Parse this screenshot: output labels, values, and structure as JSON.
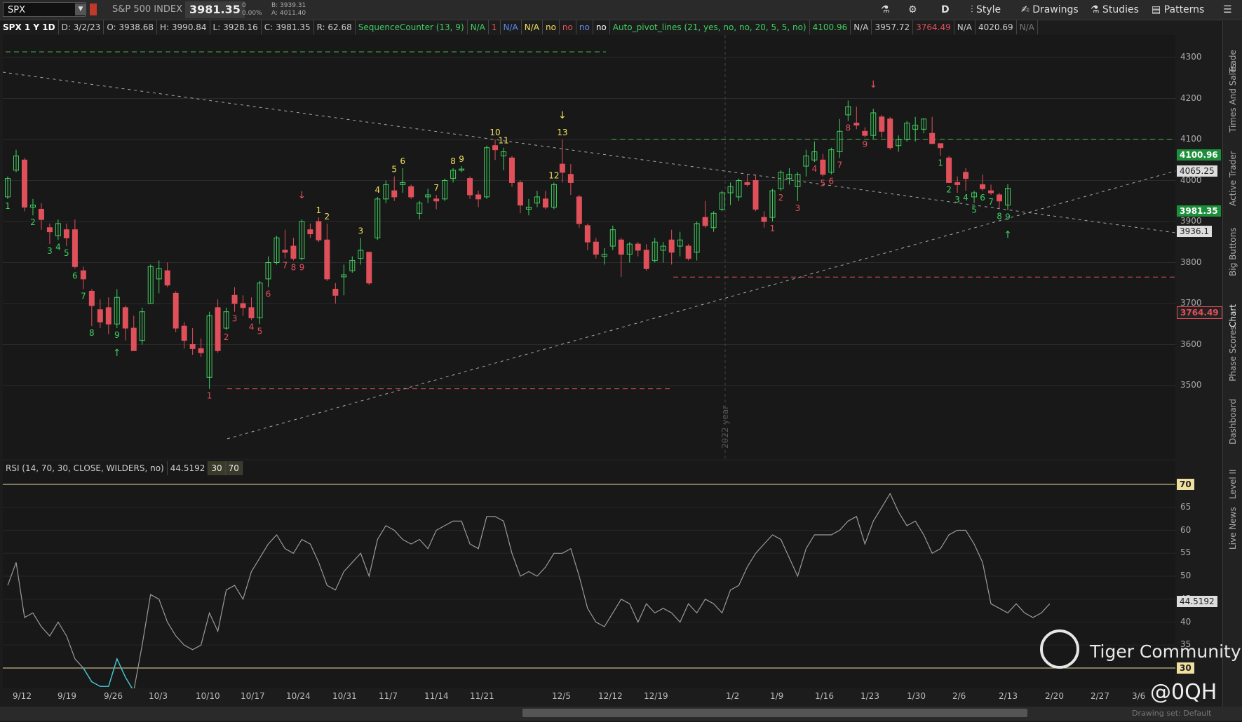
{
  "topbar": {
    "symbol": "SPX",
    "symbol_name": "S&P 500 INDEX",
    "last": "3981.35",
    "change": "0",
    "change_pct": "0.00%",
    "bid": "B: 3939.31",
    "ask": "A: 4011.40",
    "timeframe": "D",
    "buttons": [
      "Style",
      "Drawings",
      "Studies",
      "Patterns"
    ]
  },
  "subheader": {
    "title": "SPX 1 Y 1D",
    "date": "D: 3/2/23",
    "open": "O: 3938.68",
    "high": "H: 3990.84",
    "low": "L: 3928.16",
    "close": "C: 3981.35",
    "range": "R: 62.68",
    "seq": "SequenceCounter (13, 9)",
    "seq_vals": [
      "N/A",
      "1",
      "N/A",
      "N/A",
      "no",
      "no",
      "no",
      "no"
    ],
    "pivot": "Auto_pivot_lines (21, yes, no, no, 20, 5, 5, no)",
    "pivot_vals": [
      "4100.96",
      "N/A",
      "3957.72",
      "3764.49",
      "N/A",
      "4020.69",
      "N/A"
    ]
  },
  "price_axis": [
    "4300",
    "4200",
    "4100",
    "4000",
    "3900",
    "3800",
    "3700",
    "3600",
    "3500"
  ],
  "price_tags": {
    "resistance": "4100.96",
    "level2": "4065.25",
    "last": "3981.35",
    "level4": "3936.1",
    "support": "3764.49"
  },
  "rsi": {
    "label": "RSI (14, 70, 30, CLOSE, WILDERS, no)",
    "value": "44.5192",
    "os": "30",
    "ob": "70",
    "axis": [
      "65",
      "60",
      "55",
      "50",
      "45",
      "40",
      "35"
    ]
  },
  "dates": [
    "9/12",
    "9/19",
    "9/26",
    "10/3",
    "10/10",
    "10/17",
    "10/24",
    "10/31",
    "11/7",
    "11/14",
    "11/21",
    "12/5",
    "12/12",
    "12/19",
    "1/2",
    "1/9",
    "1/16",
    "1/23",
    "1/30",
    "2/6",
    "2/13",
    "2/20",
    "2/27",
    "3/6"
  ],
  "year_label": "2022 year",
  "side_tabs": [
    "Trade",
    "Times And Sales",
    "Active Trader",
    "Big Buttons",
    "Chart",
    "Phase Scores",
    "Dashboard",
    "Level II",
    "Live News"
  ],
  "watermark": "Tiger Community",
  "handle": "@0QH",
  "drawing_set": "Drawing set: Default",
  "colors": {
    "up": "#3fcf5f",
    "down": "#e0505a",
    "bg": "#181818",
    "resistance": "#3fb43f",
    "support": "#e0505a"
  },
  "candles": [
    {
      "d": "9/8",
      "o": 3960,
      "c": 4005,
      "h": 4010,
      "l": 3955
    },
    {
      "d": "9/9",
      "o": 4025,
      "c": 4060,
      "h": 4075,
      "l": 4020
    },
    {
      "d": "9/13",
      "o": 4050,
      "c": 3935,
      "h": 4055,
      "l": 3925
    },
    {
      "d": "9/14",
      "o": 3935,
      "c": 3940,
      "h": 3955,
      "l": 3915
    },
    {
      "d": "9/15",
      "o": 3930,
      "c": 3905,
      "h": 3945,
      "l": 3880
    },
    {
      "d": "9/16",
      "o": 3885,
      "c": 3875,
      "h": 3895,
      "l": 3845
    },
    {
      "d": "9/19",
      "o": 3865,
      "c": 3895,
      "h": 3905,
      "l": 3855
    },
    {
      "d": "9/20",
      "o": 3880,
      "c": 3860,
      "h": 3895,
      "l": 3840
    },
    {
      "d": "9/21",
      "o": 3880,
      "c": 3790,
      "h": 3905,
      "l": 3785
    },
    {
      "d": "9/22",
      "o": 3780,
      "c": 3760,
      "h": 3790,
      "l": 3735
    },
    {
      "d": "9/23",
      "o": 3730,
      "c": 3695,
      "h": 3735,
      "l": 3645
    },
    {
      "d": "9/26",
      "o": 3685,
      "c": 3655,
      "h": 3710,
      "l": 3640
    },
    {
      "d": "9/27",
      "o": 3690,
      "c": 3650,
      "h": 3715,
      "l": 3625
    },
    {
      "d": "9/28",
      "o": 3650,
      "c": 3715,
      "h": 3735,
      "l": 3640
    },
    {
      "d": "9/29",
      "o": 3690,
      "c": 3640,
      "h": 3695,
      "l": 3610
    },
    {
      "d": "9/30",
      "o": 3640,
      "c": 3585,
      "h": 3670,
      "l": 3585
    },
    {
      "d": "10/3",
      "o": 3610,
      "c": 3680,
      "h": 3690,
      "l": 3600
    },
    {
      "d": "10/4",
      "o": 3700,
      "c": 3790,
      "h": 3795,
      "l": 3700
    },
    {
      "d": "10/5",
      "o": 3760,
      "c": 3785,
      "h": 3805,
      "l": 3725
    },
    {
      "d": "10/6",
      "o": 3780,
      "c": 3745,
      "h": 3800,
      "l": 3740
    },
    {
      "d": "10/7",
      "o": 3725,
      "c": 3640,
      "h": 3730,
      "l": 3630
    },
    {
      "d": "10/10",
      "o": 3645,
      "c": 3610,
      "h": 3655,
      "l": 3590
    },
    {
      "d": "10/11",
      "o": 3600,
      "c": 3590,
      "h": 3640,
      "l": 3575
    },
    {
      "d": "10/12",
      "o": 3590,
      "c": 3580,
      "h": 3615,
      "l": 3570
    },
    {
      "d": "10/13",
      "o": 3520,
      "c": 3670,
      "h": 3680,
      "l": 3492
    },
    {
      "d": "10/14",
      "o": 3690,
      "c": 3585,
      "h": 3710,
      "l": 3580
    },
    {
      "d": "10/17",
      "o": 3640,
      "c": 3680,
      "h": 3690,
      "l": 3635
    },
    {
      "d": "10/18",
      "o": 3720,
      "c": 3700,
      "h": 3740,
      "l": 3680
    },
    {
      "d": "10/19",
      "o": 3700,
      "c": 3690,
      "h": 3720,
      "l": 3670
    },
    {
      "d": "10/20",
      "o": 3690,
      "c": 3665,
      "h": 3715,
      "l": 3660
    },
    {
      "d": "10/21",
      "o": 3665,
      "c": 3750,
      "h": 3755,
      "l": 3650
    },
    {
      "d": "10/24",
      "o": 3760,
      "c": 3800,
      "h": 3815,
      "l": 3740
    },
    {
      "d": "10/25",
      "o": 3800,
      "c": 3860,
      "h": 3865,
      "l": 3795
    },
    {
      "d": "10/26",
      "o": 3830,
      "c": 3825,
      "h": 3880,
      "l": 3810
    },
    {
      "d": "10/27",
      "o": 3840,
      "c": 3810,
      "h": 3860,
      "l": 3805
    },
    {
      "d": "10/28",
      "o": 3810,
      "c": 3900,
      "h": 3905,
      "l": 3805
    },
    {
      "d": "10/31",
      "o": 3880,
      "c": 3870,
      "h": 3895,
      "l": 3860
    },
    {
      "d": "11/1",
      "o": 3900,
      "c": 3855,
      "h": 3910,
      "l": 3850
    },
    {
      "d": "11/2",
      "o": 3855,
      "c": 3760,
      "h": 3895,
      "l": 3755
    },
    {
      "d": "11/3",
      "o": 3735,
      "c": 3720,
      "h": 3750,
      "l": 3700
    },
    {
      "d": "11/4",
      "o": 3765,
      "c": 3770,
      "h": 3795,
      "l": 3720
    },
    {
      "d": "11/7",
      "o": 3780,
      "c": 3805,
      "h": 3815,
      "l": 3775
    },
    {
      "d": "11/8",
      "o": 3810,
      "c": 3830,
      "h": 3860,
      "l": 3795
    },
    {
      "d": "11/9",
      "o": 3825,
      "c": 3750,
      "h": 3825,
      "l": 3745
    },
    {
      "d": "11/10",
      "o": 3860,
      "c": 3955,
      "h": 3960,
      "l": 3855
    },
    {
      "d": "11/11",
      "o": 3955,
      "c": 3990,
      "h": 4000,
      "l": 3945
    },
    {
      "d": "11/14",
      "o": 3975,
      "c": 3960,
      "h": 4010,
      "l": 3950
    },
    {
      "d": "11/15",
      "o": 3990,
      "c": 3995,
      "h": 4030,
      "l": 3970
    },
    {
      "d": "11/16",
      "o": 3985,
      "c": 3960,
      "h": 3990,
      "l": 3955
    },
    {
      "d": "11/17",
      "o": 3920,
      "c": 3945,
      "h": 3950,
      "l": 3905
    },
    {
      "d": "11/18",
      "o": 3960,
      "c": 3965,
      "h": 3980,
      "l": 3945
    },
    {
      "d": "11/21",
      "o": 3955,
      "c": 3950,
      "h": 3965,
      "l": 3930
    },
    {
      "d": "11/22",
      "o": 3955,
      "c": 4000,
      "h": 4005,
      "l": 3950
    },
    {
      "d": "11/23",
      "o": 4005,
      "c": 4025,
      "h": 4030,
      "l": 3995
    },
    {
      "d": "11/25",
      "o": 4025,
      "c": 4028,
      "h": 4035,
      "l": 4020
    },
    {
      "d": "11/28",
      "o": 4005,
      "c": 3965,
      "h": 4010,
      "l": 3955
    },
    {
      "d": "11/29",
      "o": 3965,
      "c": 3955,
      "h": 3975,
      "l": 3935
    },
    {
      "d": "11/30",
      "o": 3960,
      "c": 4080,
      "h": 4085,
      "l": 3955
    },
    {
      "d": "12/1",
      "o": 4085,
      "c": 4075,
      "h": 4100,
      "l": 4050
    },
    {
      "d": "12/2",
      "o": 4060,
      "c": 4070,
      "h": 4080,
      "l": 4025
    },
    {
      "d": "12/5",
      "o": 4055,
      "c": 3995,
      "h": 4060,
      "l": 3985
    },
    {
      "d": "12/6",
      "o": 3995,
      "c": 3940,
      "h": 4000,
      "l": 3920
    },
    {
      "d": "12/7",
      "o": 3930,
      "c": 3935,
      "h": 3955,
      "l": 3915
    },
    {
      "d": "12/8",
      "o": 3945,
      "c": 3960,
      "h": 3975,
      "l": 3935
    },
    {
      "d": "12/9",
      "o": 3955,
      "c": 3935,
      "h": 3975,
      "l": 3930
    },
    {
      "d": "12/12",
      "o": 3935,
      "c": 3990,
      "h": 3995,
      "l": 3930
    },
    {
      "d": "12/13",
      "o": 4040,
      "c": 4020,
      "h": 4100,
      "l": 3995
    },
    {
      "d": "12/14",
      "o": 4015,
      "c": 3995,
      "h": 4040,
      "l": 3965
    },
    {
      "d": "12/15",
      "o": 3960,
      "c": 3895,
      "h": 3965,
      "l": 3885
    },
    {
      "d": "12/16",
      "o": 3890,
      "c": 3850,
      "h": 3895,
      "l": 3830
    },
    {
      "d": "12/19",
      "o": 3850,
      "c": 3820,
      "h": 3860,
      "l": 3810
    },
    {
      "d": "12/20",
      "o": 3815,
      "c": 3820,
      "h": 3835,
      "l": 3795
    },
    {
      "d": "12/21",
      "o": 3840,
      "c": 3880,
      "h": 3890,
      "l": 3830
    },
    {
      "d": "12/22",
      "o": 3855,
      "c": 3820,
      "h": 3860,
      "l": 3765
    },
    {
      "d": "12/23",
      "o": 3820,
      "c": 3845,
      "h": 3850,
      "l": 3800
    },
    {
      "d": "12/27",
      "o": 3845,
      "c": 3830,
      "h": 3850,
      "l": 3815
    },
    {
      "d": "12/28",
      "o": 3830,
      "c": 3785,
      "h": 3845,
      "l": 3780
    },
    {
      "d": "12/29",
      "o": 3805,
      "c": 3850,
      "h": 3860,
      "l": 3800
    },
    {
      "d": "12/30",
      "o": 3830,
      "c": 3840,
      "h": 3850,
      "l": 3800
    },
    {
      "d": "1/3",
      "o": 3855,
      "c": 3825,
      "h": 3880,
      "l": 3795
    },
    {
      "d": "1/4",
      "o": 3840,
      "c": 3855,
      "h": 3875,
      "l": 3815
    },
    {
      "d": "1/5",
      "o": 3840,
      "c": 3810,
      "h": 3845,
      "l": 3805
    },
    {
      "d": "1/6",
      "o": 3825,
      "c": 3895,
      "h": 3900,
      "l": 3805
    },
    {
      "d": "1/9",
      "o": 3910,
      "c": 3890,
      "h": 3950,
      "l": 3885
    },
    {
      "d": "1/10",
      "o": 3885,
      "c": 3920,
      "h": 3925,
      "l": 3875
    },
    {
      "d": "1/11",
      "o": 3930,
      "c": 3970,
      "h": 3975,
      "l": 3925
    },
    {
      "d": "1/12",
      "o": 3970,
      "c": 3985,
      "h": 3995,
      "l": 3940
    },
    {
      "d": "1/13",
      "o": 3960,
      "c": 4000,
      "h": 4005,
      "l": 3950
    },
    {
      "d": "1/17",
      "o": 3995,
      "c": 3990,
      "h": 4015,
      "l": 3985
    },
    {
      "d": "1/18",
      "o": 4000,
      "c": 3930,
      "h": 4015,
      "l": 3925
    },
    {
      "d": "1/19",
      "o": 3910,
      "c": 3900,
      "h": 3925,
      "l": 3885
    },
    {
      "d": "1/20",
      "o": 3910,
      "c": 3975,
      "h": 3980,
      "l": 3900
    },
    {
      "d": "1/23",
      "o": 3980,
      "c": 4020,
      "h": 4025,
      "l": 3975
    },
    {
      "d": "1/24",
      "o": 4005,
      "c": 4015,
      "h": 4030,
      "l": 3990
    },
    {
      "d": "1/25",
      "o": 3985,
      "c": 4015,
      "h": 4020,
      "l": 3950
    },
    {
      "d": "1/26",
      "o": 4035,
      "c": 4060,
      "h": 4075,
      "l": 4010
    },
    {
      "d": "1/27",
      "o": 4050,
      "c": 4070,
      "h": 4095,
      "l": 4045
    },
    {
      "d": "1/30",
      "o": 4050,
      "c": 4015,
      "h": 4065,
      "l": 4010
    },
    {
      "d": "1/31",
      "o": 4020,
      "c": 4075,
      "h": 4080,
      "l": 4015
    },
    {
      "d": "2/1",
      "o": 4070,
      "c": 4120,
      "h": 4150,
      "l": 4055
    },
    {
      "d": "2/2",
      "o": 4160,
      "c": 4180,
      "h": 4195,
      "l": 4145
    },
    {
      "d": "2/3",
      "o": 4140,
      "c": 4135,
      "h": 4180,
      "l": 4125
    },
    {
      "d": "2/6",
      "o": 4120,
      "c": 4110,
      "h": 4130,
      "l": 4105
    },
    {
      "d": "2/7",
      "o": 4110,
      "c": 4165,
      "h": 4175,
      "l": 4100
    },
    {
      "d": "2/8",
      "o": 4155,
      "c": 4120,
      "h": 4160,
      "l": 4105
    },
    {
      "d": "2/9",
      "o": 4150,
      "c": 4080,
      "h": 4155,
      "l": 4075
    },
    {
      "d": "2/10",
      "o": 4085,
      "c": 4100,
      "h": 4110,
      "l": 4070
    },
    {
      "d": "2/13",
      "o": 4100,
      "c": 4140,
      "h": 4145,
      "l": 4095
    },
    {
      "d": "2/14",
      "o": 4125,
      "c": 4135,
      "h": 4155,
      "l": 4095
    },
    {
      "d": "2/15",
      "o": 4125,
      "c": 4150,
      "h": 4150,
      "l": 4115
    },
    {
      "d": "2/16",
      "o": 4115,
      "c": 4090,
      "h": 4155,
      "l": 4090
    },
    {
      "d": "2/17",
      "o": 4090,
      "c": 4080,
      "h": 4090,
      "l": 4060
    },
    {
      "d": "2/21",
      "o": 4055,
      "c": 3995,
      "h": 4060,
      "l": 3995
    },
    {
      "d": "2/22",
      "o": 3995,
      "c": 3990,
      "h": 4010,
      "l": 3970
    },
    {
      "d": "2/23",
      "o": 4020,
      "c": 4005,
      "h": 4030,
      "l": 3975
    },
    {
      "d": "2/24",
      "o": 3960,
      "c": 3970,
      "h": 3975,
      "l": 3945
    },
    {
      "d": "2/27",
      "o": 3990,
      "c": 3980,
      "h": 4015,
      "l": 3975
    },
    {
      "d": "2/28",
      "o": 3975,
      "c": 3970,
      "h": 3990,
      "l": 3965
    },
    {
      "d": "3/1",
      "o": 3965,
      "c": 3950,
      "h": 3970,
      "l": 3930
    },
    {
      "d": "3/2",
      "o": 3940,
      "c": 3981,
      "h": 3991,
      "l": 3928
    }
  ],
  "rsi_values": [
    48,
    53,
    41,
    42,
    39,
    37,
    40,
    37,
    32,
    30,
    27,
    26,
    26,
    32,
    28,
    25,
    35,
    46,
    45,
    40,
    37,
    35,
    34,
    35,
    42,
    38,
    47,
    48,
    45,
    51,
    54,
    57,
    59,
    56,
    55,
    58,
    57,
    53,
    48,
    47,
    51,
    53,
    55,
    50,
    58,
    61,
    60,
    58,
    57,
    58,
    56,
    60,
    61,
    62,
    62,
    57,
    56,
    63,
    63,
    62,
    55,
    50,
    51,
    50,
    52,
    55,
    55,
    56,
    50,
    43,
    40,
    39,
    42,
    45,
    44,
    40,
    44,
    42,
    43,
    42,
    40,
    44,
    42,
    45,
    44,
    42,
    47,
    48,
    52,
    55,
    57,
    59,
    58,
    54,
    50,
    56,
    59,
    59,
    59,
    60,
    62,
    63,
    57,
    62,
    65,
    68,
    64,
    61,
    62,
    59,
    55,
    56,
    59,
    60,
    60,
    57,
    53,
    44,
    43,
    42,
    44,
    42,
    41,
    42,
    44
  ]
}
